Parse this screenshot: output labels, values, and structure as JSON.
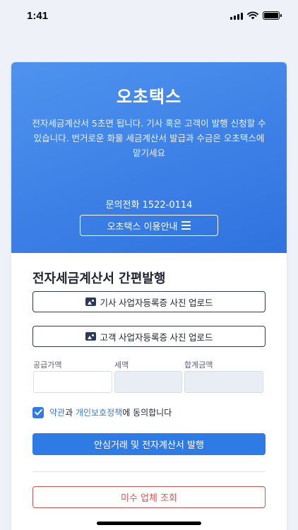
{
  "status_bar": {
    "time": "1:41"
  },
  "hero": {
    "brand": "오초택스",
    "description": "전자세금계산서 5초면 됩니다. 기사 혹은 고객이 발행 신청할 수 있습니다. 번거로운 화물 세금계산서 발급과 수금은 오초택스에 맡기세요",
    "phone_label": "문의전화 1522-0114",
    "guide_button": "오초택스 이용안내"
  },
  "form": {
    "title": "전자세금계산서 간편발행",
    "upload_driver": "기사 사업자등록증 사진 업로드",
    "upload_customer": "고객 사업자등록증 사진 업로드",
    "labels": {
      "supply": "공급가액",
      "tax": "세액",
      "total": "합계금액"
    },
    "values": {
      "supply": "",
      "tax": "",
      "total": ""
    },
    "agree": {
      "terms_link": "약관",
      "connector": "과 ",
      "privacy_link": "개인보호정책",
      "suffix": "에 동의합니다",
      "checked": true
    },
    "issue_button": "안심거래 및 전자계산서 발행",
    "unpaid_button": "미수 업체 조회"
  },
  "colors": {
    "accent": "#2f7be5",
    "danger": "#d9534f",
    "hero_gradient_start": "#4f93ee",
    "hero_gradient_end": "#2f72df"
  }
}
